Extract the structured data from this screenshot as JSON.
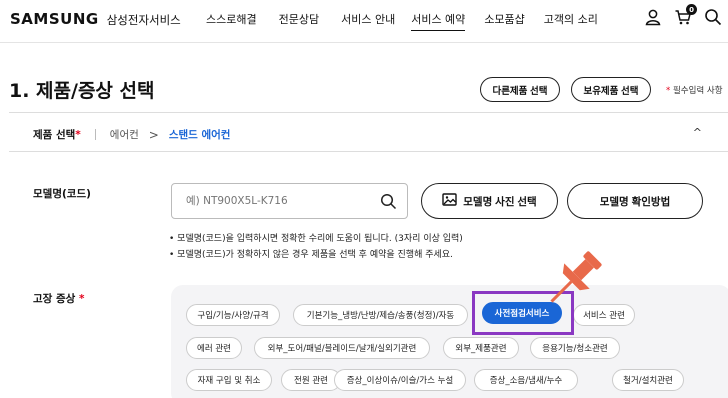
{
  "header": {
    "logo_word": "SAMSUNG",
    "logo_sub": "삼성전자서비스",
    "nav": [
      "스스로해결",
      "전문상담",
      "서비스 안내",
      "서비스 예약",
      "소모품샵",
      "고객의 소리"
    ],
    "active_nav": "서비스 예약",
    "cart_count": "0"
  },
  "page": {
    "title": "1. 제품/증상 선택",
    "other_product_btn": "다른제품 선택",
    "owned_product_btn": "보유제품 선택",
    "required_star": "*",
    "required_note": "필수입력 사항"
  },
  "product": {
    "label": "제품 선택",
    "star": "*",
    "path1": "에어컨",
    "arrow": ">",
    "path2": "스탠드 에어컨",
    "toggle": "^"
  },
  "model": {
    "label": "모델명(코드)",
    "placeholder": "예) NT900X5L-K716",
    "photo_btn": "모델명 사진 선택",
    "howto_btn": "모델명 확인방법",
    "notes": [
      "• 모델명(코드)을 입력하시면 정확한 수리에 도움이 됩니다. (3자리 이상 입력)",
      "• 모델명(코드)가 정확하지 않은 경우 제품을 선택 후 예약을 진행해 주세요."
    ]
  },
  "fault": {
    "label": "고장 증상",
    "star": "*",
    "chips": [
      "구입/기능/사양/규격",
      "기본기능_냉방/난방/제습/송풍(청정)/자동",
      "사전점검서비스",
      "서비스 관련",
      "에러 관련",
      "외부_도어/패널/블레이드/날개/실외기관련",
      "외부_제품관련",
      "응용기능/청소관련",
      "자재 구입 및 취소",
      "전원 관련",
      "증상_이상이슈/이슬/가스 누설",
      "증상_소음/냄새/누수",
      "철거/설치관련"
    ],
    "selected": "사전점검서비스"
  },
  "colors": {
    "accent": "#1a66d6",
    "highlight": "#8a38c2",
    "pin": "#e8694a",
    "required": "#e3001b"
  }
}
